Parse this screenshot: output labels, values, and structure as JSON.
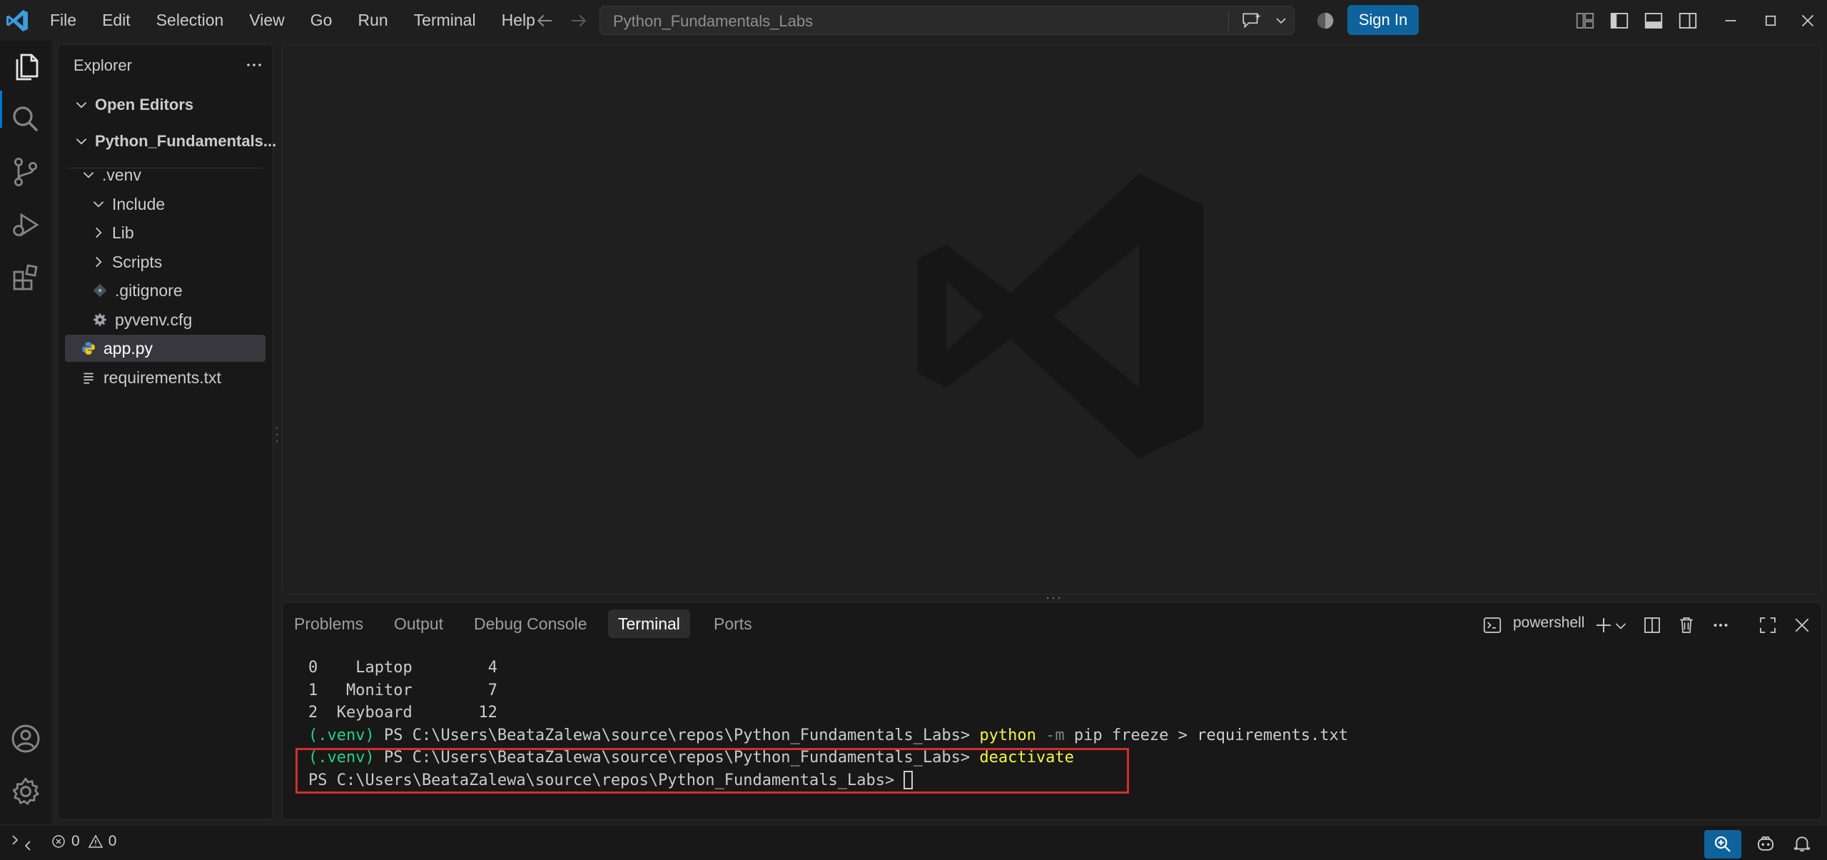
{
  "titlebar": {
    "menu": [
      "File",
      "Edit",
      "Selection",
      "View",
      "Go",
      "Run",
      "Terminal",
      "Help"
    ],
    "search_text": "Python_Fundamentals_Labs",
    "sign_in": "Sign In"
  },
  "explorer": {
    "title": "Explorer",
    "sections": {
      "open_editors": "Open Editors",
      "folder": "Python_Fundamentals..."
    },
    "tree": [
      {
        "label": ".venv",
        "type": "folder-open"
      },
      {
        "label": "Include",
        "type": "folder-open"
      },
      {
        "label": "Lib",
        "type": "folder-closed"
      },
      {
        "label": "Scripts",
        "type": "folder-closed"
      },
      {
        "label": ".gitignore",
        "type": "git-file"
      },
      {
        "label": "pyvenv.cfg",
        "type": "config-file"
      },
      {
        "label": "app.py",
        "type": "python-file"
      },
      {
        "label": "requirements.txt",
        "type": "text-file"
      }
    ]
  },
  "panel": {
    "tabs": [
      "Problems",
      "Output",
      "Debug Console",
      "Terminal",
      "Ports"
    ],
    "active_tab": "Terminal",
    "shell": "powershell",
    "terminal": {
      "rows": [
        {
          "idx": "0",
          "name": "Laptop",
          "qty": "4"
        },
        {
          "idx": "1",
          "name": "Monitor",
          "qty": "7"
        },
        {
          "idx": "2",
          "name": "Keyboard",
          "qty": "12"
        }
      ],
      "venv": "(.venv)",
      "prompt": "PS C:\\Users\\BeataZalewa\\source\\repos\\Python_Fundamentals_Labs>",
      "cmd1_exe": "python",
      "cmd1_flag": "-m",
      "cmd1_rest": "pip freeze > requirements.txt",
      "cmd2": "deactivate"
    }
  },
  "statusbar": {
    "errors": "0",
    "warnings": "0"
  },
  "colors": {
    "accent": "#0078d4",
    "button": "#0e639c",
    "highlight_box": "#d32f2f",
    "terminal_green": "#23d18b",
    "terminal_yellow": "#f5f543"
  }
}
